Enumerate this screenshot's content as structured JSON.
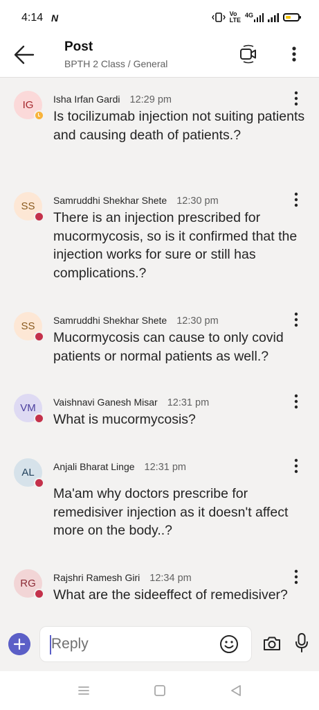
{
  "status_bar": {
    "time": "4:14",
    "nfc_glyph": "N",
    "volte_line1": "Vo",
    "volte_line2": "LTE",
    "network": "4G",
    "icons": [
      "nfc-icon",
      "vibrate-icon",
      "volte-icon",
      "signal-icon",
      "battery-icon"
    ],
    "battery_level": 0.2
  },
  "header": {
    "title": "Post",
    "subtitle": "BPTH 2 Class / General",
    "icons": [
      "back-arrow-icon",
      "video-call-icon",
      "more-vertical-icon"
    ]
  },
  "colors": {
    "accent": "#5b5fc7",
    "busy": "#c4314b",
    "away": "#f8b33a",
    "background": "#f3f2f1"
  },
  "messages": [
    {
      "initials": "IG",
      "avatar_bg": "#fbd9d9",
      "avatar_fg": "#a4262c",
      "presence": "away",
      "author": "Isha Irfan Gardi",
      "time": "12:29 pm",
      "text": "Is tocilizumab injection not suiting patients and causing death of patients.?"
    },
    {
      "initials": "SS",
      "avatar_bg": "#fde7d5",
      "avatar_fg": "#8a5a1f",
      "presence": "busy",
      "author": "Samruddhi Shekhar Shete",
      "time": "12:30 pm",
      "text": "There is an injection prescribed for mucormycosis, so is it confirmed that the injection works for sure or still has complications.?"
    },
    {
      "initials": "SS",
      "avatar_bg": "#fde7d5",
      "avatar_fg": "#8a5a1f",
      "presence": "busy",
      "author": "Samruddhi Shekhar Shete",
      "time": "12:30 pm",
      "text": "Mucormycosis can cause to only covid patients or normal patients as well.?"
    },
    {
      "initials": "VM",
      "avatar_bg": "#dedaf3",
      "avatar_fg": "#4b3f9e",
      "presence": "busy",
      "author": "Vaishnavi Ganesh Misar",
      "time": "12:31 pm",
      "text": "What is mucormycosis?"
    },
    {
      "initials": "AL",
      "avatar_bg": "#d6e2ea",
      "avatar_fg": "#1f3f5a",
      "presence": "busy",
      "author": "Anjali Bharat Linge",
      "time": "12:31 pm",
      "text": "Ma'am why doctors prescribe for remedisiver injection as it doesn't affect more on the body..?"
    },
    {
      "initials": "RG",
      "avatar_bg": "#f2d5d6",
      "avatar_fg": "#8b2a34",
      "presence": "busy",
      "author": "Rajshri Ramesh Giri",
      "time": "12:34 pm",
      "text": "What are the sideeffect of remedisiver?"
    }
  ],
  "composer": {
    "placeholder": "Reply",
    "icons": [
      "add-icon",
      "emoji-icon",
      "camera-icon",
      "microphone-icon"
    ]
  },
  "nav_bar": {
    "icons": [
      "recents-icon",
      "home-icon",
      "back-icon"
    ]
  }
}
